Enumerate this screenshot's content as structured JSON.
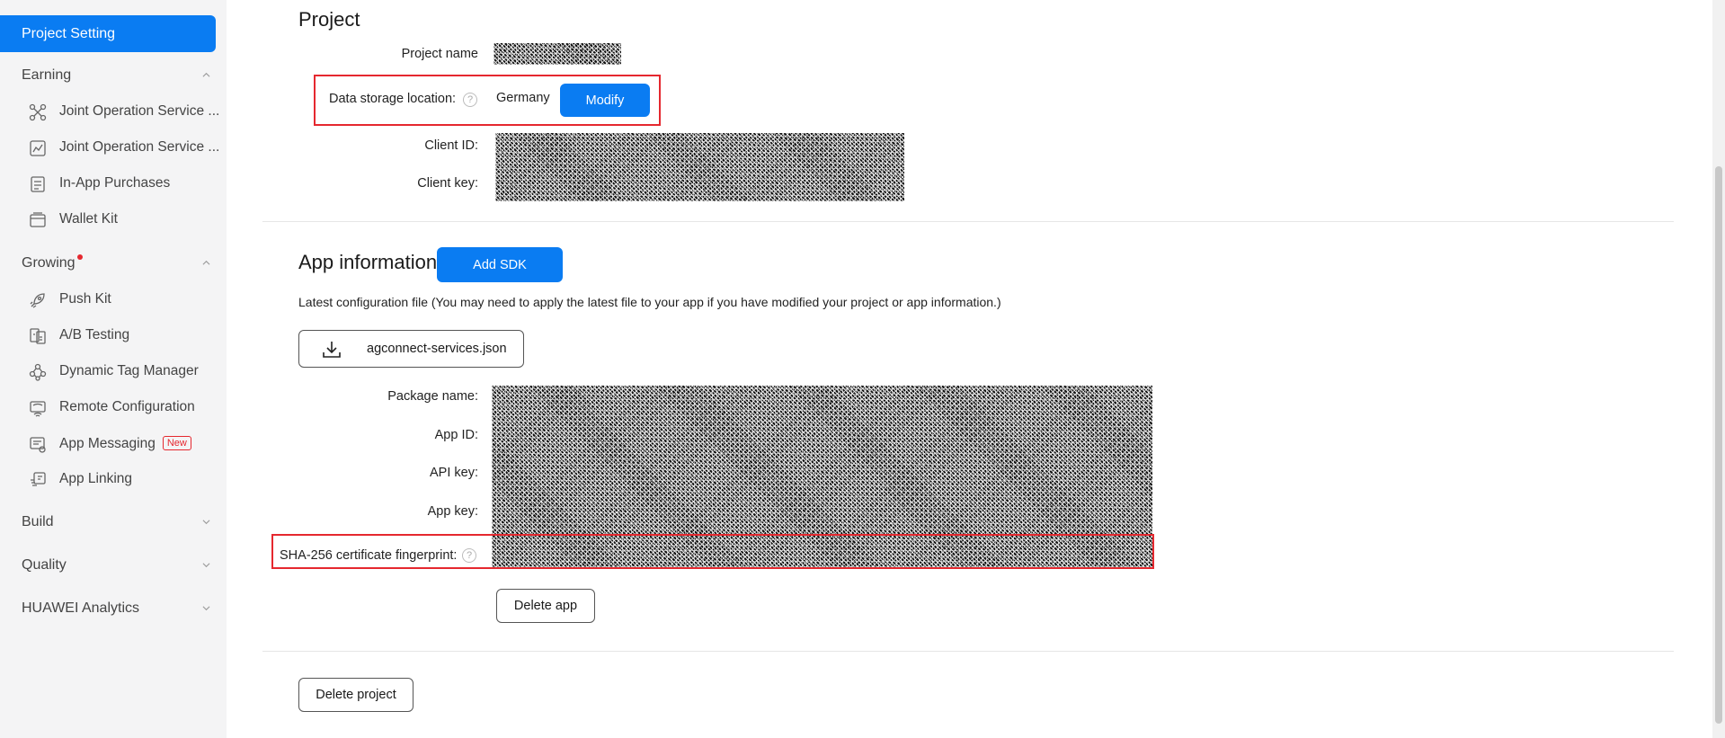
{
  "sidebar": {
    "active": "Project Setting",
    "groups": {
      "earning": "Earning",
      "growing": "Growing",
      "build": "Build",
      "quality": "Quality",
      "analytics": "HUAWEI Analytics"
    },
    "earning_items": [
      {
        "label": "Joint Operation Service ...",
        "icon": "joint-operation-icon"
      },
      {
        "label": "Joint Operation Service ...",
        "icon": "chart-box-icon"
      },
      {
        "label": "In-App Purchases",
        "icon": "purchase-icon"
      },
      {
        "label": "Wallet Kit",
        "icon": "wallet-icon"
      }
    ],
    "growing_items": [
      {
        "label": "Push Kit",
        "icon": "rocket-icon"
      },
      {
        "label": "A/B Testing",
        "icon": "ab-testing-icon"
      },
      {
        "label": "Dynamic Tag Manager",
        "icon": "tag-manager-icon"
      },
      {
        "label": "Remote Configuration",
        "icon": "remote-config-icon"
      },
      {
        "label": "App Messaging",
        "icon": "app-messaging-icon",
        "badge": "New"
      },
      {
        "label": "App Linking",
        "icon": "app-linking-icon"
      }
    ]
  },
  "project": {
    "heading": "Project",
    "name_label": "Project name",
    "storage_label": "Data storage location:",
    "storage_value": "Germany",
    "modify_label": "Modify",
    "client_id_label": "Client ID:",
    "client_key_label": "Client key:"
  },
  "app_info": {
    "heading": "App information",
    "add_sdk_label": "Add SDK",
    "config_note": "Latest configuration file (You may need to apply the latest file to your app if you have modified your project or app information.)",
    "config_file_label": "agconnect-services.json",
    "package_name_label": "Package name:",
    "app_id_label": "App ID:",
    "api_key_label": "API key:",
    "app_key_label": "App key:",
    "sha_label": "SHA-256 certificate fingerprint:",
    "delete_app_label": "Delete app"
  },
  "footer": {
    "delete_project_label": "Delete project"
  },
  "colors": {
    "accent": "#0a7cf2",
    "highlight_border": "#e5282f",
    "sidebar_bg": "#f4f4f5"
  }
}
